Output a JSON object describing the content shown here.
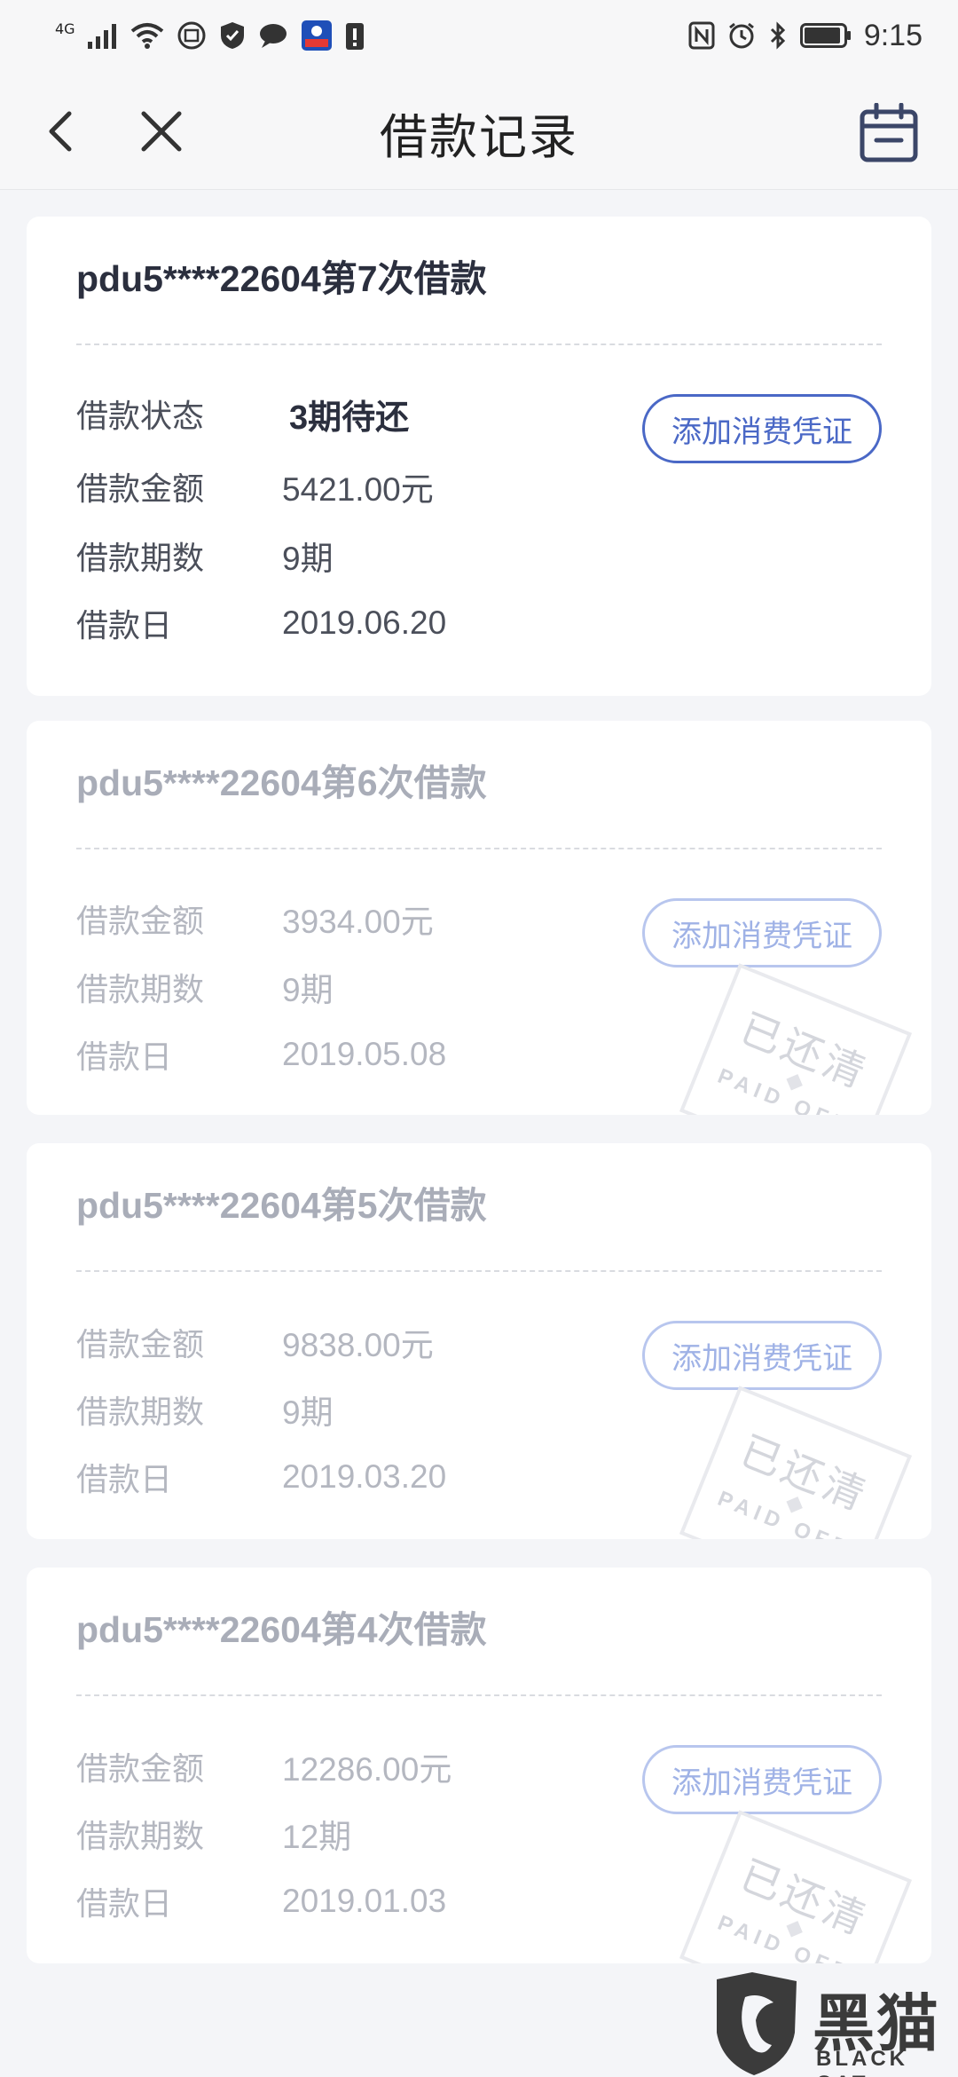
{
  "status_bar": {
    "network": "4G",
    "time": "9:15",
    "left_icons": [
      "signal-icon",
      "wifi-icon",
      "sim-icon",
      "shield-icon",
      "message-icon",
      "app-notify-icon",
      "alert-icon"
    ],
    "right_icons": [
      "nfc-icon",
      "alarm-icon",
      "bluetooth-icon",
      "battery-icon"
    ]
  },
  "nav": {
    "title": "借款记录",
    "back_icon": "chevron-left-icon",
    "close_icon": "close-icon",
    "calendar_icon": "calendar-icon"
  },
  "colors": {
    "accent": "#4a68c6",
    "accent_faded": "#b8c6ee",
    "background": "#f4f5f8",
    "title_text": "#2b2f3e",
    "muted_text": "#b4b7c0"
  },
  "labels": {
    "status": "借款状态",
    "amount": "借款金额",
    "periods": "借款期数",
    "date": "借款日",
    "voucher_button": "添加消费凭证",
    "stamp_main": "已还清",
    "stamp_sub": "PAID OFF"
  },
  "loans": [
    {
      "title": "pdu5****22604第7次借款",
      "status": "3期待还",
      "amount": "5421.00元",
      "periods": "9期",
      "date": "2019.06.20",
      "paid_off": false
    },
    {
      "title": "pdu5****22604第6次借款",
      "amount": "3934.00元",
      "periods": "9期",
      "date": "2019.05.08",
      "paid_off": true
    },
    {
      "title": "pdu5****22604第5次借款",
      "amount": "9838.00元",
      "periods": "9期",
      "date": "2019.03.20",
      "paid_off": true
    },
    {
      "title": "pdu5****22604第4次借款",
      "amount": "12286.00元",
      "periods": "12期",
      "date": "2019.01.03",
      "paid_off": true
    }
  ],
  "watermark": {
    "main": "黑猫",
    "sub": "BLACK CAT"
  }
}
